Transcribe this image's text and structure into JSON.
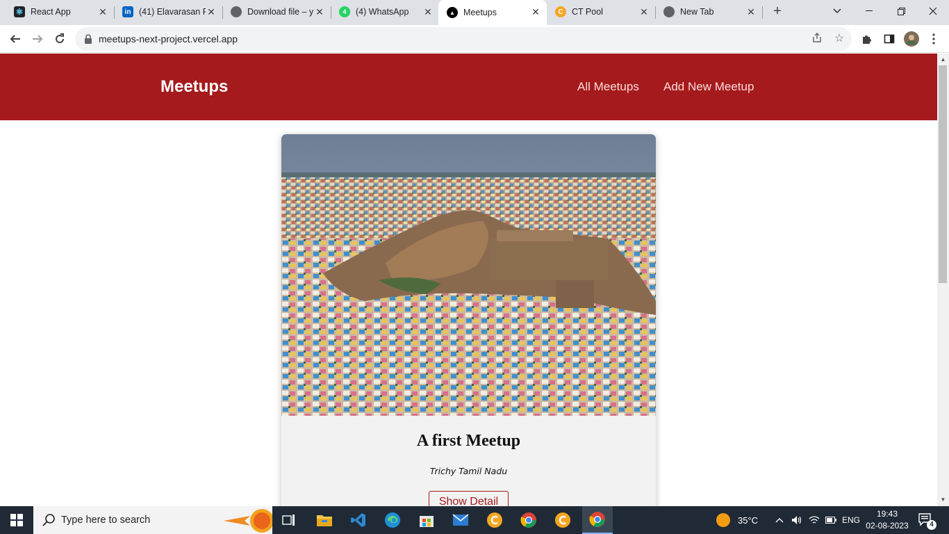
{
  "browser": {
    "tabs": [
      {
        "title": "React App",
        "icon": "react-icon",
        "active": false
      },
      {
        "title": "(41) Elavarasan R",
        "icon": "linkedin-icon",
        "active": false
      },
      {
        "title": "Download file – y",
        "icon": "globe-icon",
        "active": false
      },
      {
        "title": "(4) WhatsApp",
        "icon": "whatsapp-icon",
        "active": false
      },
      {
        "title": "Meetups",
        "icon": "vercel-icon",
        "active": true
      },
      {
        "title": "CT Pool",
        "icon": "ctpool-icon",
        "active": false
      },
      {
        "title": "New Tab",
        "icon": "chrome-icon",
        "active": false
      }
    ],
    "url": "meetups-next-project.vercel.app"
  },
  "page": {
    "header": {
      "logo": "Meetups",
      "nav": [
        "All Meetups",
        "Add New Meetup"
      ]
    },
    "meetup": {
      "title": "A first Meetup",
      "address": "Trichy Tamil Nadu",
      "button_label": "Show Detail"
    }
  },
  "taskbar": {
    "search_placeholder": "Type here to search",
    "weather": "35°C",
    "language": "ENG",
    "time": "19:43",
    "date": "02-08-2023",
    "notification_count": "4"
  },
  "colors": {
    "brand": "#a51a1c",
    "nav_text": "#fcdcdc",
    "card_bg": "#f2f2f2"
  }
}
